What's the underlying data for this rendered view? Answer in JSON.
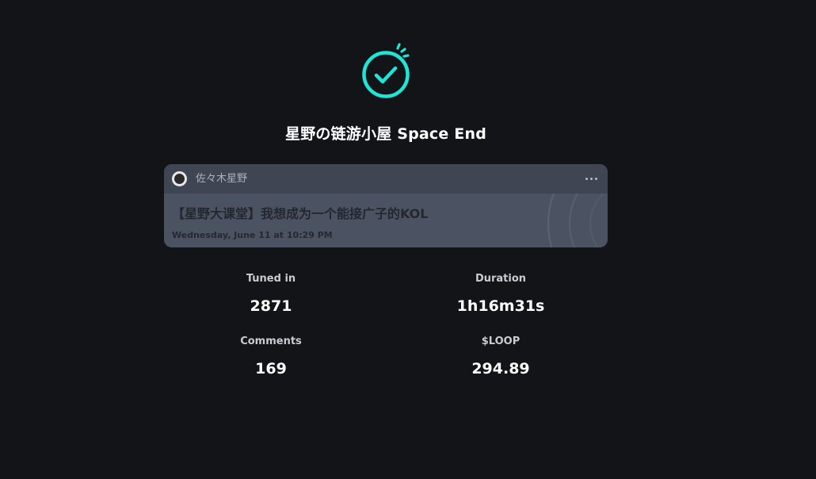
{
  "header": {
    "icon": "check-circle-icon",
    "accent_color": "#1ee6d6",
    "title": "星野の链游小屋 Space End"
  },
  "card": {
    "host_name": "佐々木星野",
    "more_icon": "more-horizontal-icon",
    "topic": "【星野大课堂】我想成为一个能接广子的KOL",
    "date": "Wednesday, June 11 at 10:29 PM"
  },
  "stats": {
    "tuned_in": {
      "label": "Tuned in",
      "value": "2871"
    },
    "duration": {
      "label": "Duration",
      "value": "1h16m31s"
    },
    "comments": {
      "label": "Comments",
      "value": "169"
    },
    "loop": {
      "label": "$LOOP",
      "value": "294.89"
    }
  }
}
